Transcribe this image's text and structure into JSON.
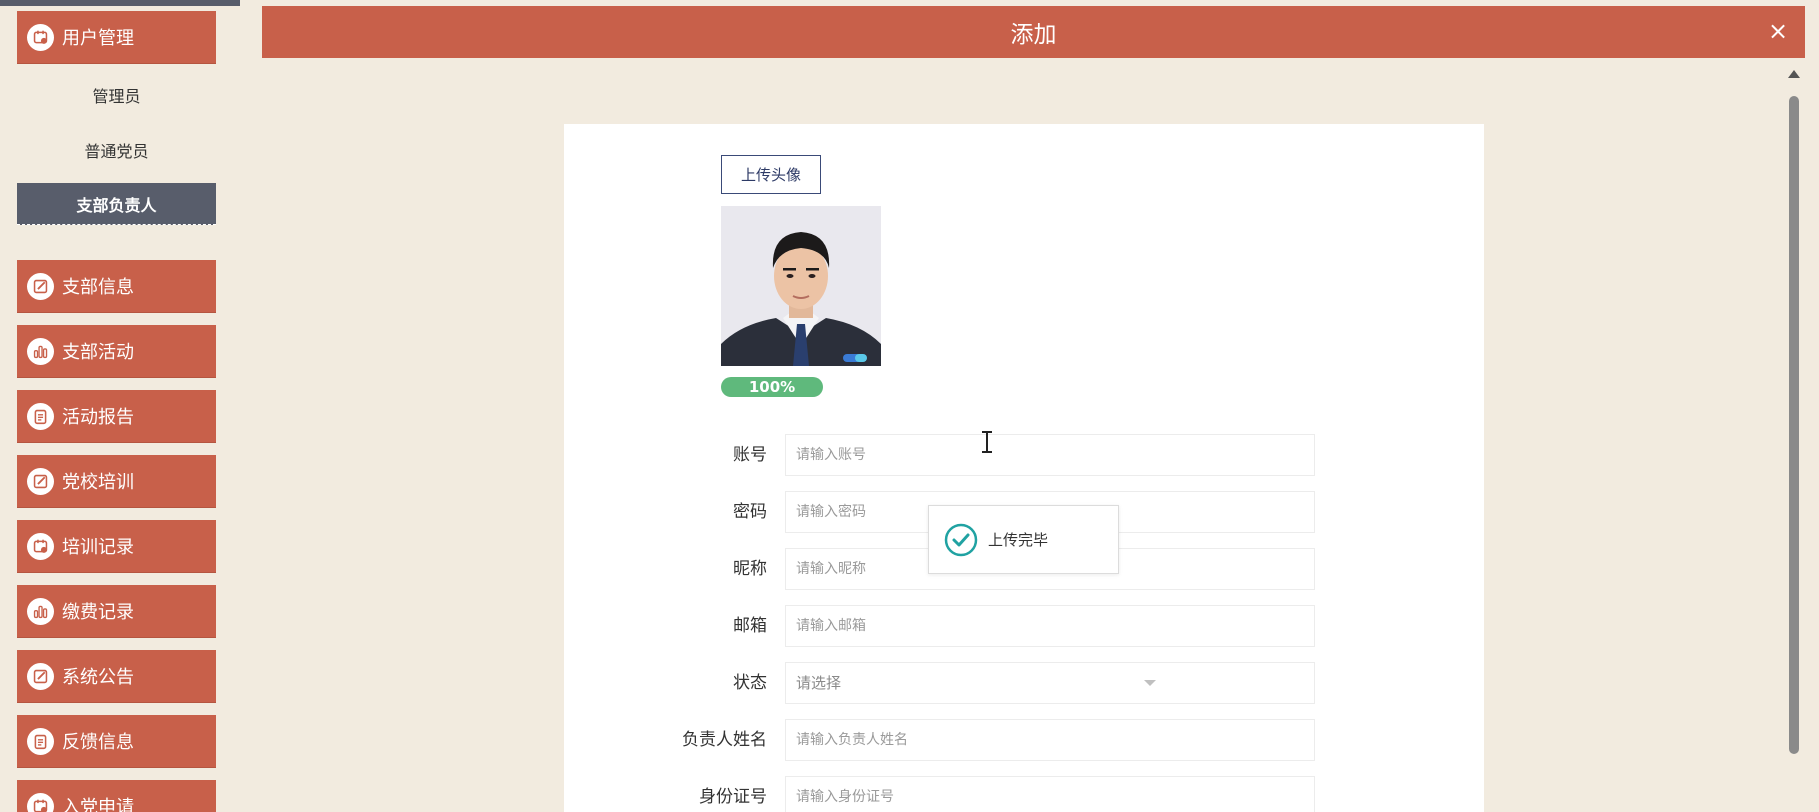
{
  "sidebar": {
    "groups": [
      {
        "label": "用户管理",
        "icon": "calendar-person-icon"
      },
      {
        "label": "支部信息",
        "icon": "edit-icon"
      },
      {
        "label": "支部活动",
        "icon": "bar-chart-icon"
      },
      {
        "label": "活动报告",
        "icon": "clipboard-icon"
      },
      {
        "label": "党校培训",
        "icon": "edit-icon"
      },
      {
        "label": "培训记录",
        "icon": "calendar-person-icon"
      },
      {
        "label": "缴费记录",
        "icon": "bar-chart-icon"
      },
      {
        "label": "系统公告",
        "icon": "edit-icon"
      },
      {
        "label": "反馈信息",
        "icon": "clipboard-icon"
      },
      {
        "label": "入党申请",
        "icon": "calendar-person-icon"
      }
    ],
    "sub_items": [
      "管理员",
      "普通党员",
      "支部负责人"
    ]
  },
  "dialog": {
    "title": "添加",
    "close_label": "×"
  },
  "form": {
    "upload_label": "上传头像",
    "progress_label": "100%",
    "fields": [
      {
        "label": "账号",
        "placeholder": "请输入账号"
      },
      {
        "label": "密码",
        "placeholder": "请输入密码"
      },
      {
        "label": "昵称",
        "placeholder": "请输入昵称"
      },
      {
        "label": "邮箱",
        "placeholder": "请输入邮箱"
      },
      {
        "label": "状态",
        "placeholder": "请选择"
      },
      {
        "label": "负责人姓名",
        "placeholder": "请输入负责人姓名"
      },
      {
        "label": "身份证号",
        "placeholder": "请输入身份证号"
      }
    ]
  },
  "toast": {
    "message": "上传完毕"
  },
  "colors": {
    "accent": "#c8604a",
    "sidebar_active": "#585d6b",
    "background": "#f2ebdf",
    "progress": "#5fb97c",
    "toast_check": "#20a2a2"
  }
}
